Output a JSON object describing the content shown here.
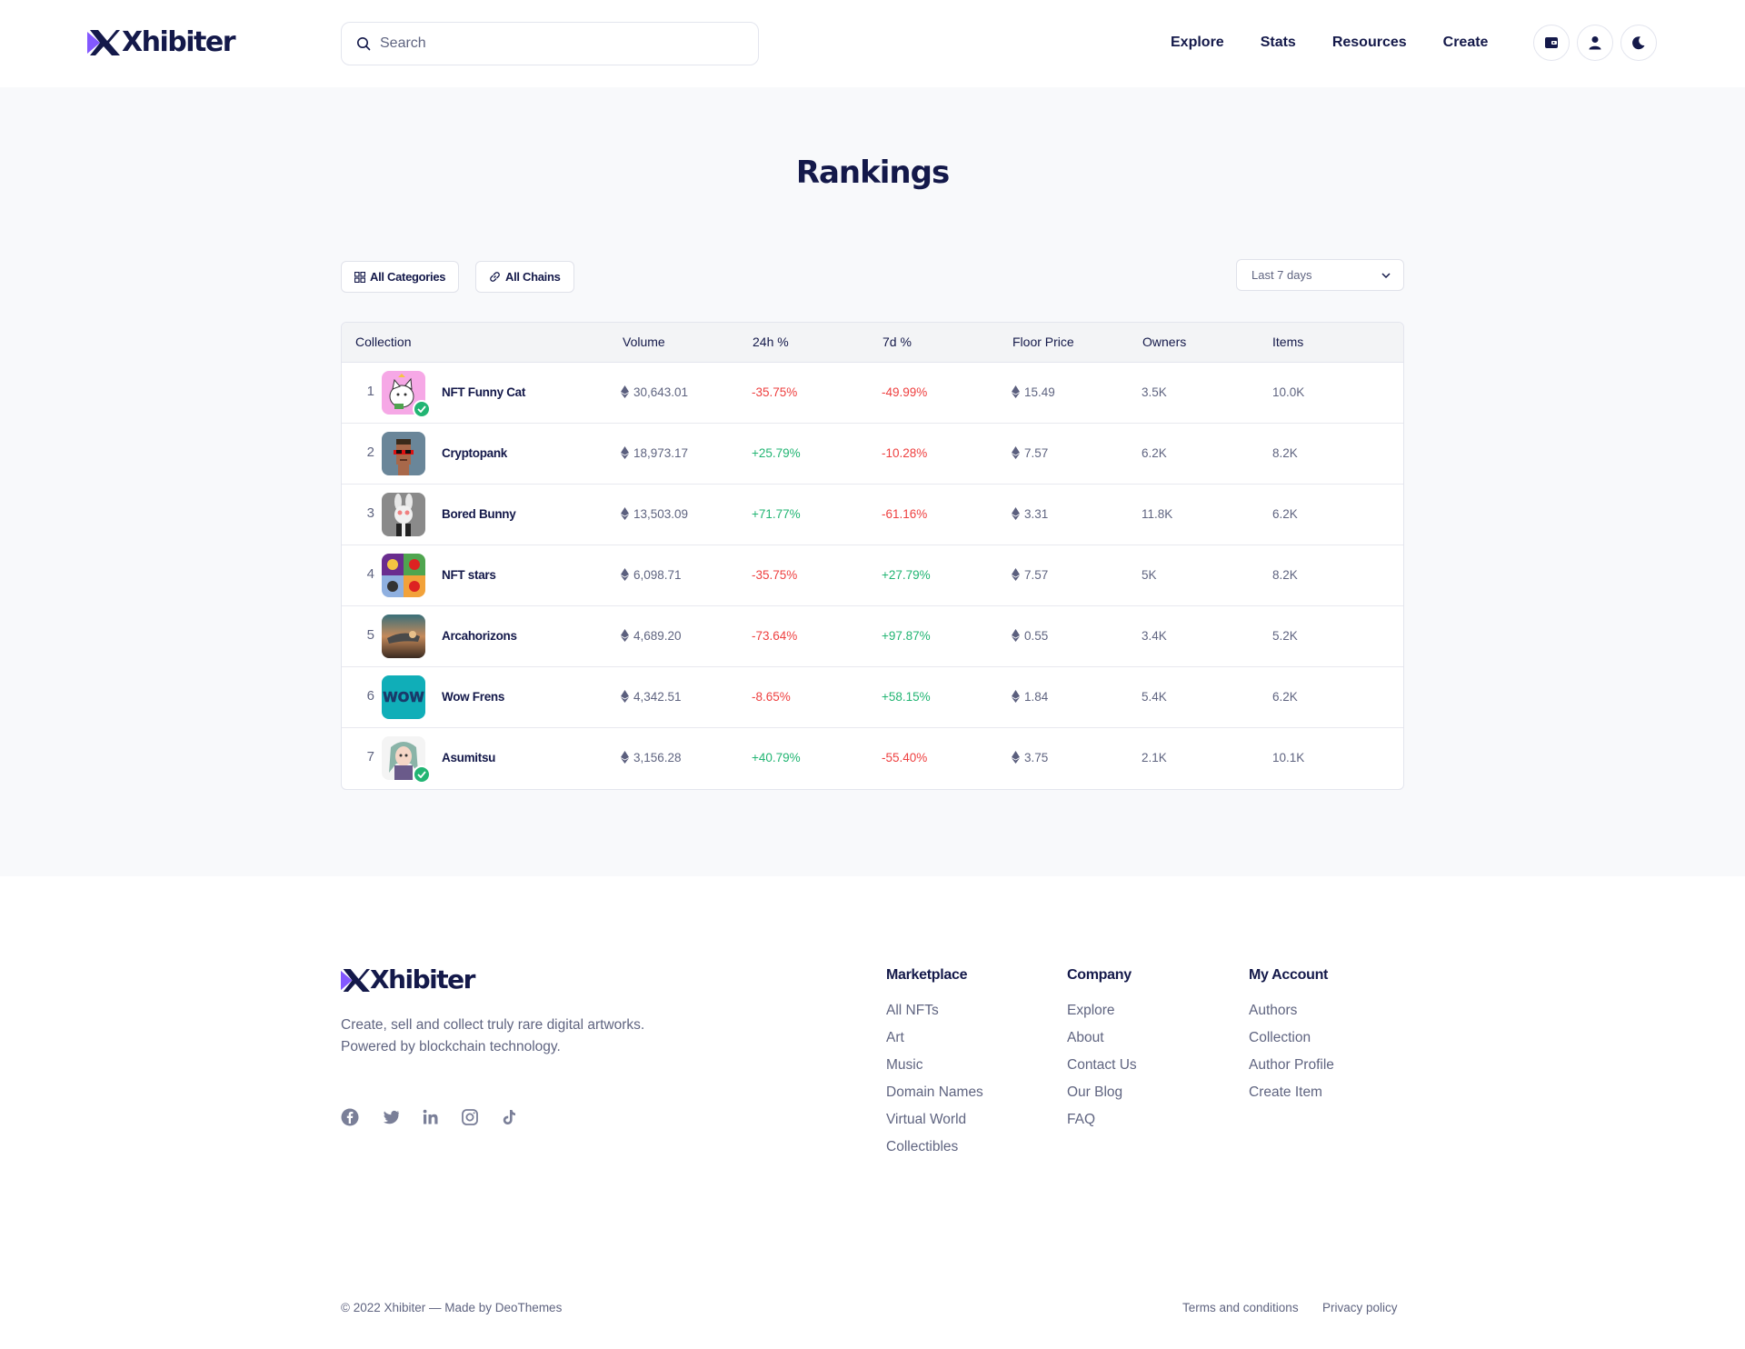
{
  "brand": {
    "name": "Xhibiter"
  },
  "search": {
    "placeholder": "Search"
  },
  "nav": {
    "items": [
      "Explore",
      "Stats",
      "Resources",
      "Create"
    ]
  },
  "header_icons": [
    "wallet-icon",
    "user-icon",
    "moon-icon"
  ],
  "page": {
    "title": "Rankings"
  },
  "filters": {
    "categories": "All Categories",
    "chains": "All Chains",
    "period": "Last 7 days"
  },
  "table": {
    "headers": [
      "Collection",
      "Volume",
      "24h %",
      "7d %",
      "Floor Price",
      "Owners",
      "Items"
    ],
    "rows": [
      {
        "rank": "1",
        "name": "NFT Funny Cat",
        "volume": "30,643.01",
        "h24": "-35.75%",
        "d7": "-49.99%",
        "floor": "15.49",
        "owners": "3.5K",
        "items": "10.0K",
        "verified": true
      },
      {
        "rank": "2",
        "name": "Cryptopank",
        "volume": "18,973.17",
        "h24": "+25.79%",
        "d7": "-10.28%",
        "floor": "7.57",
        "owners": "6.2K",
        "items": "8.2K",
        "verified": false
      },
      {
        "rank": "3",
        "name": "Bored Bunny",
        "volume": "13,503.09",
        "h24": "+71.77%",
        "d7": "-61.16%",
        "floor": "3.31",
        "owners": "11.8K",
        "items": "6.2K",
        "verified": false
      },
      {
        "rank": "4",
        "name": "NFT stars",
        "volume": "6,098.71",
        "h24": "-35.75%",
        "d7": "+27.79%",
        "floor": "7.57",
        "owners": "5K",
        "items": "8.2K",
        "verified": false
      },
      {
        "rank": "5",
        "name": "Arcahorizons",
        "volume": "4,689.20",
        "h24": "-73.64%",
        "d7": "+97.87%",
        "floor": "0.55",
        "owners": "3.4K",
        "items": "5.2K",
        "verified": false
      },
      {
        "rank": "6",
        "name": "Wow Frens",
        "volume": "4,342.51",
        "h24": "-8.65%",
        "d7": "+58.15%",
        "floor": "1.84",
        "owners": "5.4K",
        "items": "6.2K",
        "verified": false
      },
      {
        "rank": "7",
        "name": "Asumitsu",
        "volume": "3,156.28",
        "h24": "+40.79%",
        "d7": "-55.40%",
        "floor": "3.75",
        "owners": "2.1K",
        "items": "10.1K",
        "verified": true
      }
    ]
  },
  "colors": {
    "positive": "#22b573",
    "negative": "#ee3f3f",
    "accent": "#8358ff",
    "text": "#14194a"
  },
  "footer": {
    "description": [
      "Create, sell and collect truly rare digital artworks.",
      "Powered by blockchain technology."
    ],
    "social": [
      "facebook-icon",
      "twitter-icon",
      "linkedin-icon",
      "instagram-icon",
      "tiktok-icon"
    ],
    "columns": [
      {
        "title": "Marketplace",
        "links": [
          "All NFTs",
          "Art",
          "Music",
          "Domain Names",
          "Virtual World",
          "Collectibles"
        ]
      },
      {
        "title": "Company",
        "links": [
          "Explore",
          "About",
          "Contact Us",
          "Our Blog",
          "FAQ"
        ]
      },
      {
        "title": "My Account",
        "links": [
          "Authors",
          "Collection",
          "Author Profile",
          "Create Item"
        ]
      }
    ],
    "copyright": "© 2022 Xhibiter — Made by DeoThemes",
    "legal": [
      "Terms and conditions",
      "Privacy policy"
    ]
  }
}
